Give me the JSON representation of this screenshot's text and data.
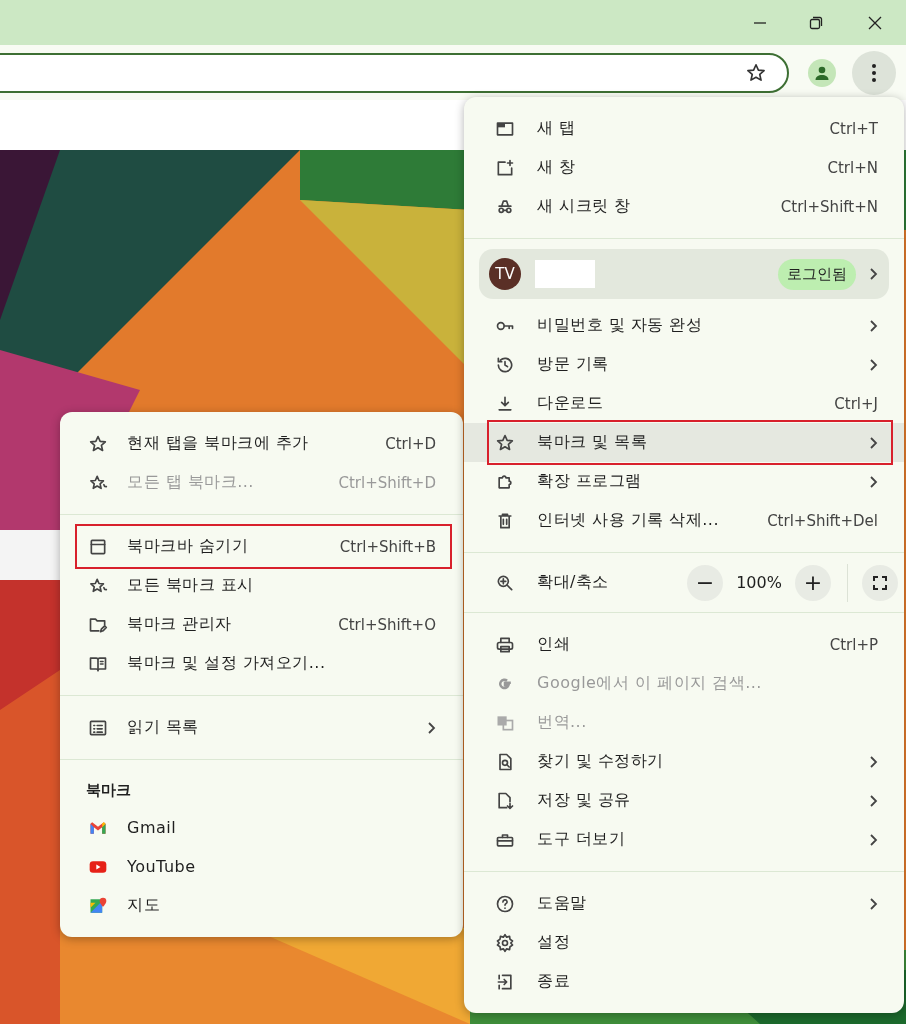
{
  "main_menu": {
    "sections": [
      {
        "items": [
          {
            "kind": "item",
            "label": "새 탭",
            "shortcut": "Ctrl+T",
            "submenu": false,
            "disabled": false,
            "selected": false,
            "highlighted": false
          },
          {
            "kind": "item",
            "label": "새 창",
            "shortcut": "Ctrl+N",
            "submenu": false,
            "disabled": false,
            "selected": false,
            "highlighted": false
          },
          {
            "kind": "item",
            "label": "새 시크릿 창",
            "shortcut": "Ctrl+Shift+N",
            "submenu": false,
            "disabled": false,
            "selected": false,
            "highlighted": false
          }
        ]
      },
      {
        "items": [
          {
            "kind": "profile",
            "initials": "TV",
            "badge": "로그인됨",
            "submenu": true
          },
          {
            "kind": "item",
            "label": "비밀번호 및 자동 완성",
            "submenu": true,
            "disabled": false,
            "selected": false,
            "highlighted": false
          },
          {
            "kind": "item",
            "label": "방문 기록",
            "submenu": true,
            "disabled": false,
            "selected": false,
            "highlighted": false
          },
          {
            "kind": "item",
            "label": "다운로드",
            "shortcut": "Ctrl+J",
            "submenu": false,
            "disabled": false,
            "selected": false,
            "highlighted": false
          },
          {
            "kind": "item",
            "label": "북마크 및 목록",
            "submenu": true,
            "disabled": false,
            "selected": true,
            "highlighted": true
          },
          {
            "kind": "item",
            "label": "확장 프로그램",
            "submenu": true,
            "disabled": false,
            "selected": false,
            "highlighted": false
          },
          {
            "kind": "item",
            "label": "인터넷 사용 기록 삭제...",
            "shortcut": "Ctrl+Shift+Del",
            "submenu": false,
            "disabled": false,
            "selected": false,
            "highlighted": false
          }
        ]
      },
      {
        "items": [
          {
            "kind": "zoom",
            "label": "확대/축소",
            "zoom_out": "−",
            "value": "100%",
            "zoom_in": "+"
          }
        ]
      },
      {
        "items": [
          {
            "kind": "item",
            "label": "인쇄",
            "shortcut": "Ctrl+P",
            "submenu": false,
            "disabled": false,
            "selected": false,
            "highlighted": false
          },
          {
            "kind": "item",
            "label": "Google에서 이 페이지 검색...",
            "submenu": false,
            "disabled": true,
            "selected": false,
            "highlighted": false
          },
          {
            "kind": "item",
            "label": "번역...",
            "submenu": false,
            "disabled": true,
            "selected": false,
            "highlighted": false
          },
          {
            "kind": "item",
            "label": "찾기 및 수정하기",
            "submenu": true,
            "disabled": false,
            "selected": false,
            "highlighted": false
          },
          {
            "kind": "item",
            "label": "저장 및 공유",
            "submenu": true,
            "disabled": false,
            "selected": false,
            "highlighted": false
          },
          {
            "kind": "item",
            "label": "도구 더보기",
            "submenu": true,
            "disabled": false,
            "selected": false,
            "highlighted": false
          }
        ]
      },
      {
        "items": [
          {
            "kind": "item",
            "label": "도움말",
            "submenu": true,
            "disabled": false,
            "selected": false,
            "highlighted": false
          },
          {
            "kind": "item",
            "label": "설정",
            "submenu": false,
            "disabled": false,
            "selected": false,
            "highlighted": false
          },
          {
            "kind": "item",
            "label": "종료",
            "submenu": false,
            "disabled": false,
            "selected": false,
            "highlighted": false
          }
        ]
      }
    ]
  },
  "bookmarks_submenu": {
    "sections": [
      {
        "items": [
          {
            "kind": "item",
            "label": "현재 탭을 북마크에 추가",
            "shortcut": "Ctrl+D",
            "submenu": false,
            "disabled": false,
            "selected": false,
            "highlighted": false
          },
          {
            "kind": "item",
            "label": "모든 탭 북마크...",
            "shortcut": "Ctrl+Shift+D",
            "submenu": false,
            "disabled": true,
            "selected": false,
            "highlighted": false
          }
        ]
      },
      {
        "items": [
          {
            "kind": "item",
            "label": "북마크바 숨기기",
            "shortcut": "Ctrl+Shift+B",
            "submenu": false,
            "disabled": false,
            "selected": false,
            "highlighted": true
          },
          {
            "kind": "item",
            "label": "모든 북마크 표시",
            "submenu": false,
            "disabled": false,
            "selected": false,
            "highlighted": false
          },
          {
            "kind": "item",
            "label": "북마크 관리자",
            "shortcut": "Ctrl+Shift+O",
            "submenu": false,
            "disabled": false,
            "selected": false,
            "highlighted": false
          },
          {
            "kind": "item",
            "label": "북마크 및 설정 가져오기...",
            "submenu": false,
            "disabled": false,
            "selected": false,
            "highlighted": false
          }
        ]
      },
      {
        "items": [
          {
            "kind": "item",
            "label": "읽기 목록",
            "submenu": true,
            "disabled": false,
            "selected": false,
            "highlighted": false
          }
        ]
      },
      {
        "items": [
          {
            "kind": "header",
            "label": "북마크"
          },
          {
            "kind": "item",
            "label": "Gmail",
            "submenu": false,
            "disabled": false,
            "selected": false,
            "highlighted": false
          },
          {
            "kind": "item",
            "label": "YouTube",
            "submenu": false,
            "disabled": false,
            "selected": false,
            "highlighted": false
          },
          {
            "kind": "item",
            "label": "지도",
            "submenu": false,
            "disabled": false,
            "selected": false,
            "highlighted": false
          }
        ]
      }
    ]
  }
}
